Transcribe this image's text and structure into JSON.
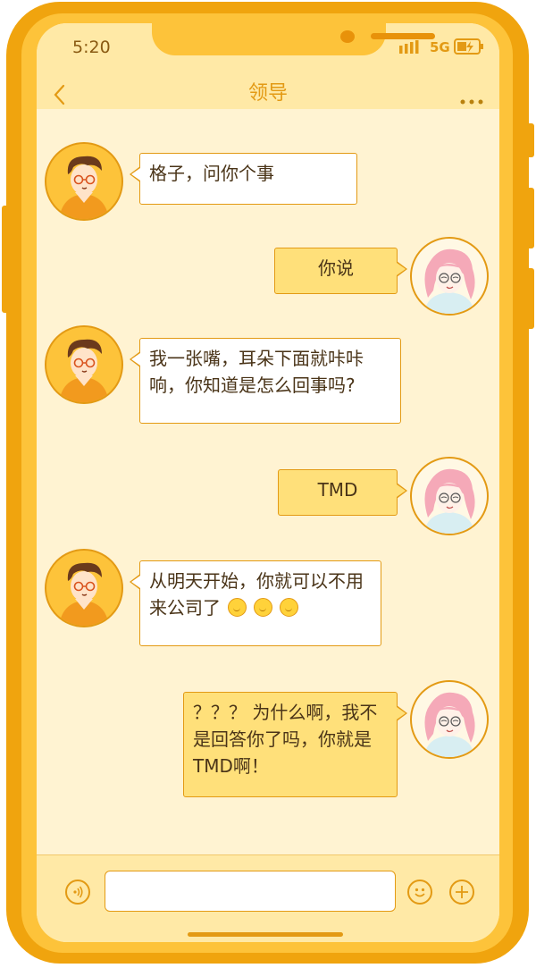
{
  "status": {
    "time": "5:20",
    "network": "5G"
  },
  "header": {
    "title": "领导",
    "back_icon": "chevron-left-icon",
    "more_icon": "more-dots-icon"
  },
  "messages": [
    {
      "side": "left",
      "text": "格子，问你个事"
    },
    {
      "side": "right",
      "text": "你说"
    },
    {
      "side": "left",
      "text": "我一张嘴，耳朵下面就咔咔响，你知道是怎么回事吗?"
    },
    {
      "side": "right",
      "text": "TMD"
    },
    {
      "side": "left",
      "text": "从明天开始，你就可以不用来公司了",
      "emoji_count": 3
    },
    {
      "side": "right",
      "text": "？？？ 为什么啊，我不是回答你了吗，你就是TMD啊！"
    }
  ],
  "input_bar": {
    "voice_icon": "voice-icon",
    "emoji_icon": "smiley-icon",
    "add_icon": "plus-icon",
    "placeholder": ""
  },
  "colors": {
    "frame": "#F0A40E",
    "accent": "#E39A14",
    "bubble_right": "#FFE07A",
    "background": "#FFF3D2"
  }
}
